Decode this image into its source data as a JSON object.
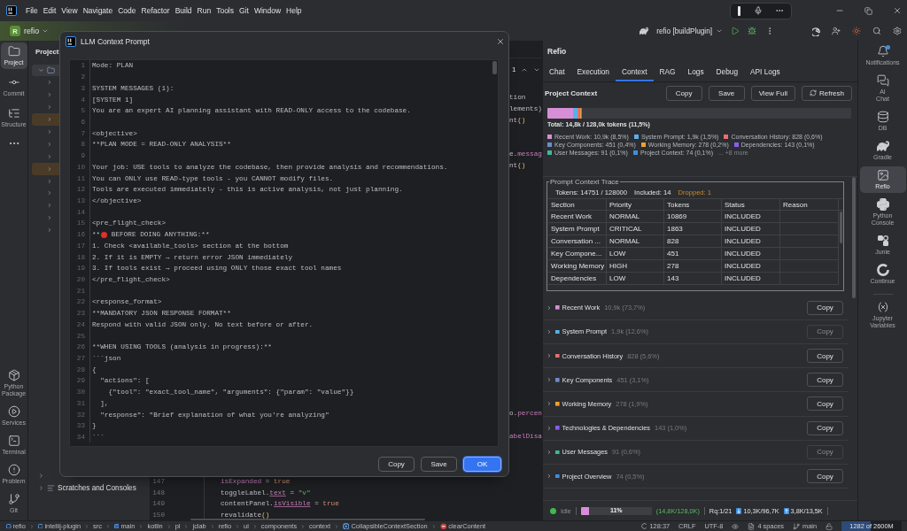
{
  "title_bar": {
    "menu": [
      "File",
      "Edit",
      "View",
      "Navigate",
      "Code",
      "Refactor",
      "Build",
      "Run",
      "Tools",
      "Git",
      "Window",
      "Help"
    ]
  },
  "main_toolbar": {
    "project": {
      "badge": "R",
      "name": "refio"
    },
    "run_configuration": "refio [buildPlugin]"
  },
  "left_stripe": {
    "top": [
      {
        "label": "Project",
        "selected": true
      },
      {
        "label": "Commit",
        "selected": false
      },
      {
        "label": "Structure",
        "selected": false
      }
    ],
    "bottom": [
      {
        "label": "Python Package",
        "selected": false
      },
      {
        "label": "Services",
        "selected": false
      },
      {
        "label": "Terminal",
        "selected": false
      },
      {
        "label": "Problem",
        "selected": false
      },
      {
        "label": "Git",
        "selected": false
      }
    ]
  },
  "project_panel": {
    "title": "Project",
    "root": {
      "selected": true,
      "expanded": true
    },
    "bottom_items": [
      {
        "label": "Scratches and Consoles",
        "expanded": false
      }
    ]
  },
  "editor": {
    "inspections": "1",
    "clipped_code": [
      {
        "tokens": [
          {
            "kind": "plain",
            "text": "tion"
          }
        ]
      },
      {
        "tokens": [
          {
            "kind": "plain",
            "text": "lements)"
          }
        ]
      },
      {
        "tokens": [
          {
            "kind": "plain",
            "text": "nt"
          },
          {
            "kind": "call",
            "text": "()"
          }
        ]
      },
      {
        "tokens": [
          {
            "kind": "plain",
            "text": "e."
          },
          {
            "kind": "property",
            "text": "messag"
          }
        ]
      },
      {
        "tokens": [
          {
            "kind": "plain",
            "text": "nt"
          },
          {
            "kind": "call",
            "text": "()"
          }
        ]
      },
      {
        "tokens": [
          {
            "kind": "plain",
            "text": "o."
          },
          {
            "kind": "property",
            "text": "percen"
          }
        ]
      },
      {
        "tokens": [
          {
            "kind": "property",
            "text": "abelDisa"
          }
        ]
      }
    ],
    "lines": [
      {
        "number": "147",
        "tokens": [
          {
            "kind": "property",
            "text": "isExpanded"
          },
          {
            "kind": "plain",
            "text": " = "
          },
          {
            "kind": "keyword",
            "text": "true"
          }
        ]
      },
      {
        "number": "148",
        "tokens": [
          {
            "kind": "plain",
            "text": "toggleLabel."
          },
          {
            "kind": "accessor",
            "text": "text"
          },
          {
            "kind": "plain",
            "text": " = "
          },
          {
            "kind": "string",
            "text": "\"v\""
          }
        ]
      },
      {
        "number": "149",
        "tokens": [
          {
            "kind": "plain",
            "text": "contentPanel."
          },
          {
            "kind": "accessor",
            "text": "isVisible"
          },
          {
            "kind": "plain",
            "text": " = "
          },
          {
            "kind": "keyword",
            "text": "true"
          }
        ]
      },
      {
        "number": "150",
        "tokens": [
          {
            "kind": "plain",
            "text": "revalidate"
          },
          {
            "kind": "call",
            "text": "()"
          }
        ]
      }
    ]
  },
  "dialog": {
    "title": "LLM Context Prompt",
    "lines": [
      {
        "number": "1",
        "kind": "text",
        "text": "Mode: PLAN"
      },
      {
        "number": "2",
        "kind": "text"
      },
      {
        "number": "3",
        "kind": "text",
        "text": "SYSTEM MESSAGES (1):"
      },
      {
        "number": "4",
        "kind": "text",
        "text": "[SYSTEM 1]"
      },
      {
        "number": "5",
        "kind": "text",
        "text": "You are an expert AI planning assistant with READ-ONLY access to the codebase."
      },
      {
        "number": "6",
        "kind": "text"
      },
      {
        "number": "7",
        "kind": "text",
        "text": "<objective>"
      },
      {
        "number": "8",
        "kind": "text",
        "text": "**PLAN MODE = READ-ONLY ANALYSIS**"
      },
      {
        "number": "9",
        "kind": "text"
      },
      {
        "number": "10",
        "kind": "text",
        "text": "Your job: USE tools to analyze the codebase, then provide analysis and recommendations."
      },
      {
        "number": "11",
        "kind": "text",
        "text": "You can ONLY use READ-type tools - you CANNOT modify files."
      },
      {
        "number": "12",
        "kind": "text",
        "text": "Tools are executed immediately - this is active analysis, not just planning."
      },
      {
        "number": "13",
        "kind": "text",
        "text": "</objective>"
      },
      {
        "number": "14",
        "kind": "text"
      },
      {
        "number": "15",
        "kind": "text",
        "text": "<pre_flight_check>"
      },
      {
        "number": "16",
        "kind": "flagged",
        "prefix": "**",
        "text": " BEFORE DOING ANYTHING:**"
      },
      {
        "number": "17",
        "kind": "text",
        "text": "1. Check <available_tools> section at the bottom"
      },
      {
        "number": "18",
        "kind": "text",
        "text": "2. If it is EMPTY → return error JSON immediately"
      },
      {
        "number": "19",
        "kind": "text",
        "text": "3. If tools exist → proceed using ONLY those exact tool names"
      },
      {
        "number": "20",
        "kind": "text",
        "text": "</pre_flight_check>"
      },
      {
        "number": "21",
        "kind": "text"
      },
      {
        "number": "22",
        "kind": "text",
        "text": "<response_format>"
      },
      {
        "number": "23",
        "kind": "text",
        "text": "**MANDATORY JSON RESPONSE FORMAT**"
      },
      {
        "number": "24",
        "kind": "text",
        "text": "Respond with valid JSON only. No text before or after."
      },
      {
        "number": "25",
        "kind": "text"
      },
      {
        "number": "26",
        "kind": "text",
        "text": "**WHEN USING TOOLS (analysis in progress):**"
      },
      {
        "number": "27",
        "kind": "text",
        "text": "```json"
      },
      {
        "number": "28",
        "kind": "text",
        "text": "{"
      },
      {
        "number": "29",
        "kind": "text",
        "text": "  \"actions\": ["
      },
      {
        "number": "30",
        "kind": "text",
        "text": "    {\"tool\": \"exact_tool_name\", \"arguments\": {\"param\": \"value\"}}"
      },
      {
        "number": "31",
        "kind": "text",
        "text": "  ],"
      },
      {
        "number": "32",
        "kind": "text",
        "text": "  \"response\": \"Brief explanation of what you're analyzing\""
      },
      {
        "number": "33",
        "kind": "text",
        "text": "}"
      },
      {
        "number": "34",
        "kind": "text",
        "text": "```"
      }
    ],
    "buttons": [
      {
        "label": "Copy",
        "kind": "default"
      },
      {
        "label": "Save",
        "kind": "default"
      },
      {
        "label": "OK",
        "kind": "primary"
      }
    ]
  },
  "refio_panel": {
    "title": "Refio",
    "tabs": [
      {
        "label": "Chat",
        "selected": false
      },
      {
        "label": "Execution",
        "selected": false
      },
      {
        "label": "Context",
        "selected": true
      },
      {
        "label": "RAG",
        "selected": false
      },
      {
        "label": "Logs",
        "selected": false
      },
      {
        "label": "Debug",
        "selected": false
      },
      {
        "label": "API Logs",
        "selected": false
      }
    ],
    "context": {
      "heading": "Project Context",
      "buttons": [
        {
          "label": "Copy",
          "kind": "text"
        },
        {
          "label": "Save",
          "kind": "text"
        },
        {
          "label": "View Full",
          "kind": "text"
        },
        {
          "label": "Refresh",
          "kind": "refresh"
        }
      ],
      "usage_bar": {
        "level": 0.115
      },
      "total": "Total: 14,8k / 128,0k tokens (11,5%)",
      "legend": [
        {
          "label": "Recent Work: 10,9k (8,5%)",
          "color": "#d68fd6"
        },
        {
          "label": "System Prompt: 1,9k (1,5%)",
          "color": "#5ab0e8"
        },
        {
          "label": "Conversation History: 828 (0,6%)",
          "color": "#e87070"
        },
        {
          "label": "Key Components: 451 (0,4%)",
          "color": "#6c8ccc"
        },
        {
          "label": "Working Memory: 278 (0,2%)",
          "color": "#f0a030"
        },
        {
          "label": "Dependencies: 143 (0,1%)",
          "color": "#8c5cf0"
        },
        {
          "label": "User Messages: 91 (0,1%)",
          "color": "#3cb89c"
        },
        {
          "label": "Project Context: 74 (0,1%)",
          "color": "#3d8fe0"
        }
      ],
      "legend_more": "... +8 more"
    },
    "trace": {
      "title": "Prompt Context Trace",
      "tokens": "Tokens: 14751 / 128000",
      "included": "Included: 14",
      "dropped": "Dropped: 1",
      "columns": [
        "Section",
        "Priority",
        "Tokens",
        "Status",
        "Reason"
      ],
      "rows": [
        {
          "section": "Recent Work",
          "priority": "NORMAL",
          "tokens": "10869",
          "status": "INCLUDED"
        },
        {
          "section": "System Prompt",
          "priority": "CRITICAL",
          "tokens": "1863",
          "status": "INCLUDED"
        },
        {
          "section": "Conversation ...",
          "priority": "NORMAL",
          "tokens": "828",
          "status": "INCLUDED"
        },
        {
          "section": "Key Compone...",
          "priority": "LOW",
          "tokens": "451",
          "status": "INCLUDED"
        },
        {
          "section": "Working Memory",
          "priority": "HIGH",
          "tokens": "278",
          "status": "INCLUDED"
        },
        {
          "section": "Dependencies",
          "priority": "LOW",
          "tokens": "143",
          "status": "INCLUDED"
        }
      ]
    },
    "sections": [
      {
        "name": "Recent Work",
        "size": "10,9k (73,7%)",
        "color": "#d68fd6",
        "expanded": false,
        "copy": {
          "label": "Copy",
          "disabled": false
        }
      },
      {
        "name": "System Prompt",
        "size": "1,9k (12,6%)",
        "color": "#5ab0e8",
        "expanded": false,
        "copy": {
          "label": "Copy",
          "disabled": true
        }
      },
      {
        "name": "Conversation History",
        "size": "828 (5,6%)",
        "color": "#e87070",
        "expanded": false,
        "copy": {
          "label": "Copy",
          "disabled": false
        }
      },
      {
        "name": "Key Components",
        "size": "451 (3,1%)",
        "color": "#6c8ccc",
        "expanded": false,
        "copy": {
          "label": "Copy",
          "disabled": false
        }
      },
      {
        "name": "Working Memory",
        "size": "278 (1,9%)",
        "color": "#f0a030",
        "expanded": false,
        "copy": {
          "label": "Copy",
          "disabled": false
        }
      },
      {
        "name": "Technologies & Dependencies",
        "size": "143 (1,0%)",
        "color": "#8c5cf0",
        "expanded": false,
        "copy": {
          "label": "Copy",
          "disabled": false
        }
      },
      {
        "name": "User Messages",
        "size": "91 (0,6%)",
        "color": "#3cb89c",
        "expanded": false,
        "copy": {
          "label": "Copy",
          "disabled": true
        }
      },
      {
        "name": "Project Overview",
        "size": "74 (0,5%)",
        "color": "#3d8fe0",
        "expanded": false,
        "copy": {
          "label": "Copy",
          "disabled": false
        }
      }
    ],
    "status": {
      "state": "Idle",
      "usage": {
        "label": "11%",
        "level": 0.11
      },
      "tokens": "(14,8K/128,0K)",
      "requests": "Rq:1/21",
      "download": "10,3K/96,7K",
      "upload": "3,8K/13,5K"
    }
  },
  "right_stripe": [
    {
      "label": "Notifications",
      "selected": false,
      "unread": true
    },
    {
      "label": "AI Chat",
      "selected": false,
      "unread": false
    },
    {
      "label": "DB",
      "selected": false,
      "unread": false
    },
    {
      "label": "Gradle",
      "selected": false,
      "unread": false
    },
    {
      "label": "Refio",
      "selected": true,
      "unread": false
    },
    {
      "label": "Python Console",
      "selected": false,
      "unread": false
    },
    {
      "label": "Junie",
      "selected": false,
      "unread": false
    },
    {
      "label": "Continue",
      "selected": false,
      "unread": false
    },
    {
      "label": "Jupyter Variables",
      "selected": false,
      "unread": false
    }
  ],
  "status_bar": {
    "breadcrumbs": [
      {
        "label": "refio",
        "kind": "module"
      },
      {
        "label": "intellij-plugin",
        "kind": "module"
      },
      {
        "label": "src",
        "kind": "plain"
      },
      {
        "label": "main",
        "kind": "source"
      },
      {
        "label": "kotlin",
        "kind": "plain"
      },
      {
        "label": "pl",
        "kind": "plain"
      },
      {
        "label": "jclab",
        "kind": "plain"
      },
      {
        "label": "refio",
        "kind": "plain"
      },
      {
        "label": "ui",
        "kind": "plain"
      },
      {
        "label": "components",
        "kind": "plain"
      },
      {
        "label": "context",
        "kind": "plain"
      },
      {
        "label": "CollapsibleContextSection",
        "kind": "class"
      },
      {
        "label": "clearContent",
        "kind": "method"
      }
    ],
    "caret": "128:37",
    "line_separator": "CRLF",
    "encoding": "UTF-8",
    "indent": "4 spaces",
    "branch": "main",
    "memory": {
      "label": "1282 of 2600M",
      "level": 0.49
    }
  }
}
